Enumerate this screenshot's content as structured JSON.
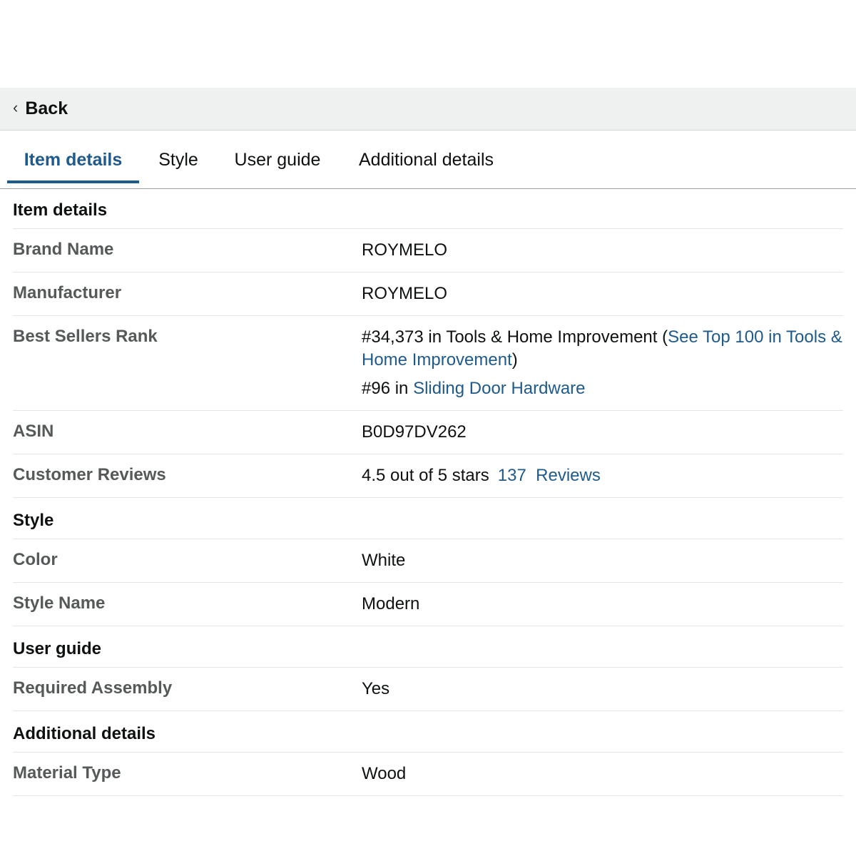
{
  "back": {
    "label": "Back"
  },
  "tabs": [
    {
      "label": "Item details",
      "active": true
    },
    {
      "label": "Style",
      "active": false
    },
    {
      "label": "User guide",
      "active": false
    },
    {
      "label": "Additional details",
      "active": false
    }
  ],
  "sections": {
    "item_details": {
      "title": "Item details",
      "brand_name": {
        "key": "Brand Name",
        "value": "ROYMELO"
      },
      "manufacturer": {
        "key": "Manufacturer",
        "value": "ROYMELO"
      },
      "best_sellers_rank": {
        "key": "Best Sellers Rank",
        "rank1_text": "#34,373 in Tools & Home Improvement (",
        "rank1_link": "See Top 100 in Tools & Home Improvement",
        "rank1_close": ")",
        "rank2_text": "#96 in ",
        "rank2_link": "Sliding Door Hardware"
      },
      "asin": {
        "key": "ASIN",
        "value": "B0D97DV262"
      },
      "customer_reviews": {
        "key": "Customer Reviews",
        "value": "4.5 out of 5 stars",
        "rating": 4.5,
        "reviews_link": "137  Reviews"
      }
    },
    "style": {
      "title": "Style",
      "color": {
        "key": "Color",
        "value": "White"
      },
      "style_name": {
        "key": "Style Name",
        "value": "Modern"
      }
    },
    "user_guide": {
      "title": "User guide",
      "required_assembly": {
        "key": "Required Assembly",
        "value": "Yes"
      }
    },
    "additional_details": {
      "title": "Additional details",
      "material_type": {
        "key": "Material Type",
        "value": "Wood"
      }
    }
  },
  "colors": {
    "link": "#1f5a8c",
    "key_text": "#565959",
    "back_bar": "#eff1f1"
  }
}
